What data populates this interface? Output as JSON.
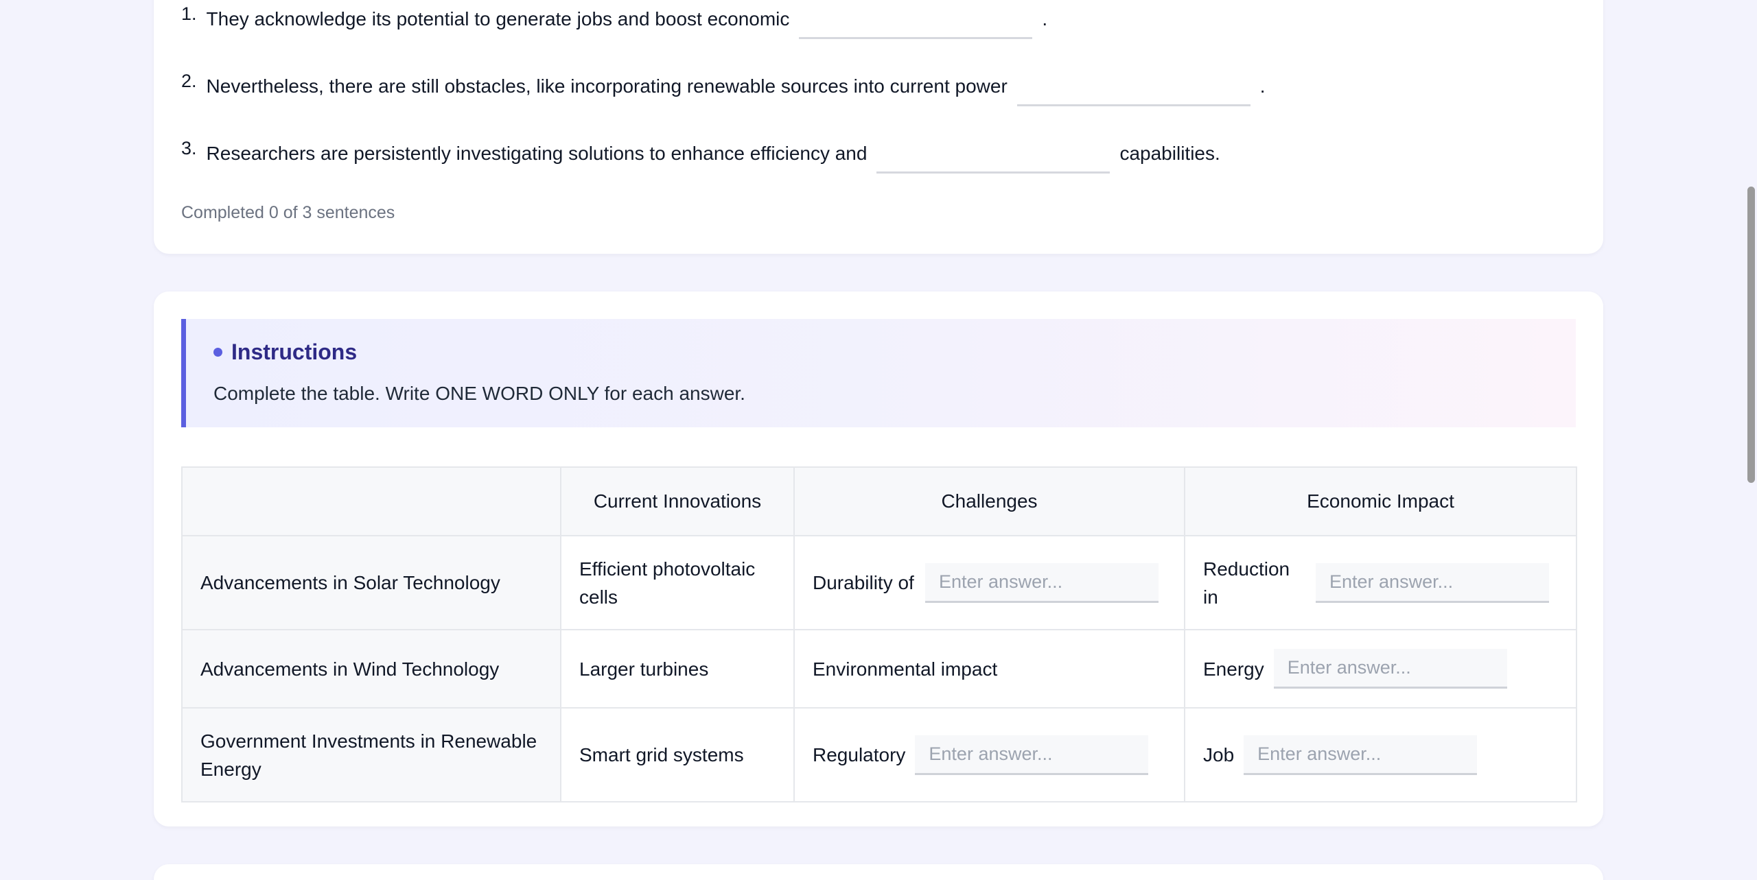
{
  "sentences": [
    {
      "num": "1.",
      "before": "They acknowledge its potential to generate jobs and boost economic",
      "after": "."
    },
    {
      "num": "2.",
      "before": "Nevertheless, there are still obstacles, like incorporating renewable sources into current power",
      "after": "."
    },
    {
      "num": "3.",
      "before": "Researchers are persistently investigating solutions to enhance efficiency and",
      "after": "capabilities."
    }
  ],
  "progress": "Completed 0 of 3 sentences",
  "instructions": {
    "title": "Instructions",
    "text": "Complete the table. Write ONE WORD ONLY for each answer."
  },
  "table": {
    "headers": [
      "",
      "Current Innovations",
      "Challenges",
      "Economic Impact"
    ],
    "placeholder": "Enter answer...",
    "rows": [
      {
        "label": "Advancements in Solar Technology",
        "innovation": "Efficient photovoltaic cells",
        "challenge_prefix": "Durability of",
        "impact_prefix": "Reduction in"
      },
      {
        "label": "Advancements in Wind Technology",
        "innovation": "Larger turbines",
        "challenge_text": "Environmental impact",
        "impact_prefix": "Energy"
      },
      {
        "label": "Government Investments in Renewable Energy",
        "innovation": "Smart grid systems",
        "challenge_prefix": "Regulatory",
        "impact_prefix": "Job"
      }
    ]
  },
  "colors": {
    "accent": "#5b5fe0",
    "instruction_title": "#2e2a86",
    "page_background": "#f3f3fd"
  }
}
